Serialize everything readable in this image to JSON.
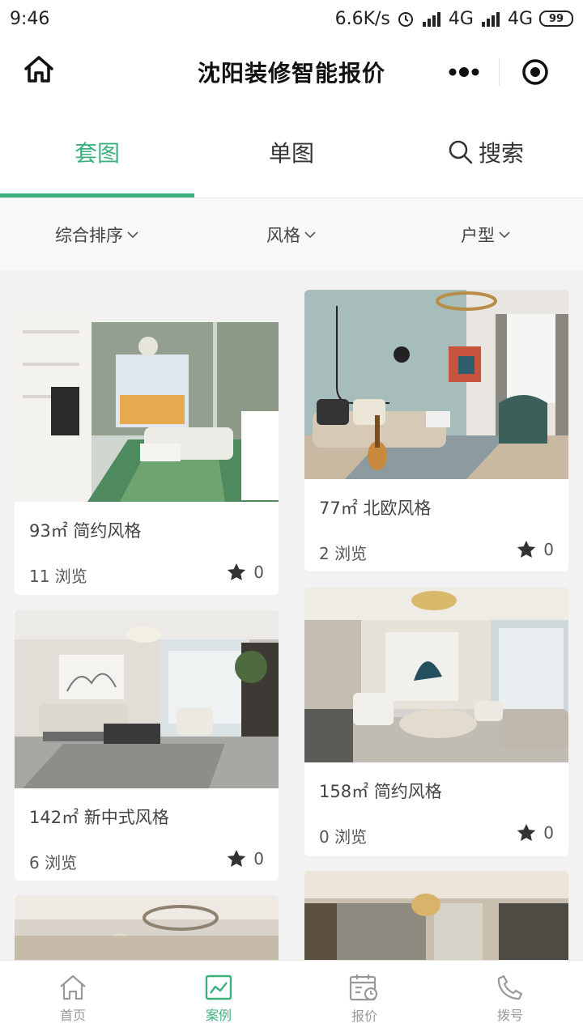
{
  "status_bar": {
    "time": "9:46",
    "net_speed": "6.6K/s",
    "signal_1": "4G",
    "signal_2": "4G",
    "battery": "99"
  },
  "header": {
    "title": "沈阳装修智能报价"
  },
  "tabs": [
    {
      "label": "套图",
      "active": true
    },
    {
      "label": "单图",
      "active": false
    },
    {
      "label": "搜索",
      "active": false
    }
  ],
  "filters": [
    {
      "label": "综合排序"
    },
    {
      "label": "风格"
    },
    {
      "label": "户型"
    }
  ],
  "cards": [
    {
      "title": "93㎡ 简约风格",
      "views": "11 浏览",
      "favorites": "0"
    },
    {
      "title": "77㎡ 北欧风格",
      "views": "2 浏览",
      "favorites": "0"
    },
    {
      "title": "142㎡ 新中式风格",
      "views": "6 浏览",
      "favorites": "0"
    },
    {
      "title": "158㎡ 简约风格",
      "views": "0 浏览",
      "favorites": "0"
    }
  ],
  "bottom_nav": [
    {
      "label": "首页",
      "icon": "home-icon",
      "active": false
    },
    {
      "label": "案例",
      "icon": "chart-icon",
      "active": true
    },
    {
      "label": "报价",
      "icon": "calendar-icon",
      "active": false
    },
    {
      "label": "拨号",
      "icon": "phone-icon",
      "active": false
    }
  ],
  "colors": {
    "accent": "#3bb07f",
    "text": "#333333",
    "muted": "#999999"
  }
}
